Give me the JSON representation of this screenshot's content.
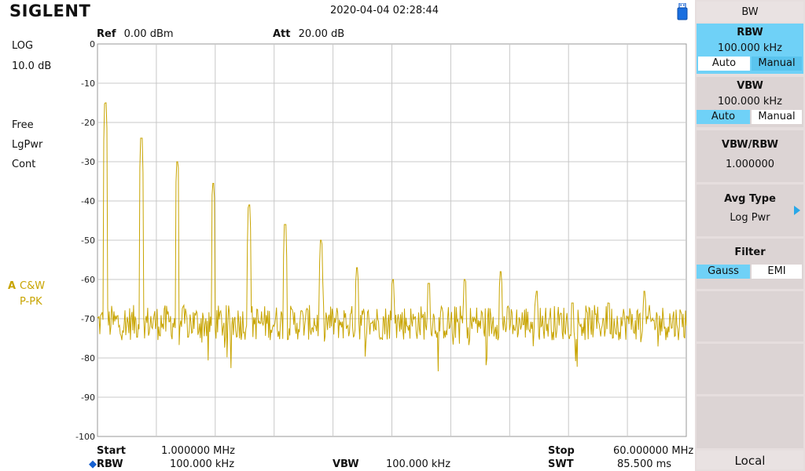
{
  "header": {
    "brand": "SIGLENT",
    "datetime": "2020-04-04   02:28:44"
  },
  "left": {
    "scale": "LOG",
    "scale_div": "10.0 dB",
    "trig": "Free",
    "det_mode": "LgPwr",
    "sweep": "Cont",
    "trace_id": "A",
    "trace_mode": "C&W",
    "trace_det": "P-PK"
  },
  "top": {
    "ref_label": "Ref",
    "ref_value": "0.00 dBm",
    "att_label": "Att",
    "att_value": "20.00 dB"
  },
  "bottom": {
    "start_label": "Start",
    "start_value": "1.000000 MHz",
    "rbw_label": "RBW",
    "rbw_value": "100.000 kHz",
    "vbw_label": "VBW",
    "vbw_value": "100.000 kHz",
    "stop_label": "Stop",
    "stop_value": "60.000000 MHz",
    "swt_label": "SWT",
    "swt_value": "85.500 ms"
  },
  "panel": {
    "title": "BW",
    "rbw": {
      "label": "RBW",
      "value": "100.000 kHz",
      "opt_auto": "Auto",
      "opt_manual": "Manual"
    },
    "vbw": {
      "label": "VBW",
      "value": "100.000 kHz",
      "opt_auto": "Auto",
      "opt_manual": "Manual"
    },
    "ratio": {
      "label": "VBW/RBW",
      "value": "1.000000"
    },
    "avg": {
      "label": "Avg Type",
      "value": "Log Pwr"
    },
    "filter": {
      "label": "Filter",
      "opt_gauss": "Gauss",
      "opt_emi": "EMI"
    },
    "local": "Local"
  },
  "colors": {
    "trace": "#c8a400",
    "accent": "#6fd1f7",
    "grid": "#c8c8c8"
  },
  "chart_data": {
    "type": "line",
    "x_unit": "MHz",
    "y_unit": "dBm",
    "xlim": [
      1,
      60
    ],
    "ylim": [
      -100,
      0
    ],
    "y_ticks": [
      0,
      -10,
      -20,
      -30,
      -40,
      -50,
      -60,
      -70,
      -80,
      -90,
      -100
    ],
    "grid": true,
    "noise_floor": -71,
    "peaks": [
      {
        "x": 1.8,
        "y": -15
      },
      {
        "x": 5.4,
        "y": -24
      },
      {
        "x": 9.0,
        "y": -30
      },
      {
        "x": 12.6,
        "y": -35.5
      },
      {
        "x": 16.2,
        "y": -41
      },
      {
        "x": 19.8,
        "y": -46
      },
      {
        "x": 23.4,
        "y": -50
      },
      {
        "x": 27.0,
        "y": -57
      },
      {
        "x": 30.6,
        "y": -60
      },
      {
        "x": 34.2,
        "y": -61
      },
      {
        "x": 37.8,
        "y": -60
      },
      {
        "x": 41.4,
        "y": -58
      },
      {
        "x": 45.0,
        "y": -63
      },
      {
        "x": 48.6,
        "y": -66
      },
      {
        "x": 52.2,
        "y": -66
      },
      {
        "x": 55.8,
        "y": -63
      }
    ]
  }
}
